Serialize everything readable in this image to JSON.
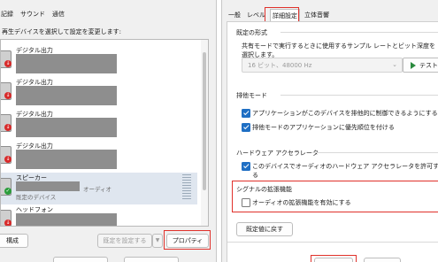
{
  "left_dialog": {
    "tabs": [
      "記録",
      "サウンド",
      "通信"
    ],
    "instruction": "再生デバイスを選択して設定を変更します:",
    "devices": [
      {
        "name": "デジタル出力",
        "status": "error",
        "selected": false,
        "sub": "",
        "sub2": ""
      },
      {
        "name": "デジタル出力",
        "status": "error",
        "selected": false,
        "sub": "",
        "sub2": ""
      },
      {
        "name": "デジタル出力",
        "status": "error",
        "selected": false,
        "sub": "",
        "sub2": ""
      },
      {
        "name": "デジタル出力",
        "status": "error",
        "selected": false,
        "sub": "",
        "sub2": ""
      },
      {
        "name": "スピーカー",
        "status": "ok",
        "selected": true,
        "sub": "既定のデバイス",
        "sub2": "オーディオ"
      },
      {
        "name": "ヘッドフォン",
        "status": "error",
        "selected": false,
        "sub": "",
        "sub2": ""
      }
    ],
    "buttons": {
      "configure": "構成",
      "set_default": "既定を設定する",
      "properties": "プロパティ"
    }
  },
  "right_dialog": {
    "tabs": [
      "一般",
      "レベル",
      "詳細設定",
      "立体音響"
    ],
    "active_tab": "詳細設定",
    "default_format": {
      "heading": "既定の形式",
      "description": "共有モードで実行するときに使用するサンプル レートとビット深度を選択します。",
      "value": "16 ビット、48000 Hz",
      "test_label": "テスト"
    },
    "exclusive_mode": {
      "heading": "排他モード",
      "options": [
        {
          "label": "アプリケーションがこのデバイスを排他的に制御できるようにする",
          "checked": true
        },
        {
          "label": "排他モードのアプリケーションに優先順位を付ける",
          "checked": true
        }
      ]
    },
    "hw_accel": {
      "heading": "ハードウェア アクセラレータ",
      "option": {
        "label": "このデバイスでオーディオのハードウェア アクセラレータを許可する",
        "checked": true
      }
    },
    "signal_enh": {
      "heading": "シグナルの拡張機能",
      "option": {
        "label": "オーディオの拡張機能を有効にする",
        "checked": false
      }
    },
    "restore_label": "既定値に戻す"
  },
  "colors": {
    "highlight": "#e0312b",
    "checkbox": "#1f6fc4",
    "play": "#2a8a3e"
  }
}
